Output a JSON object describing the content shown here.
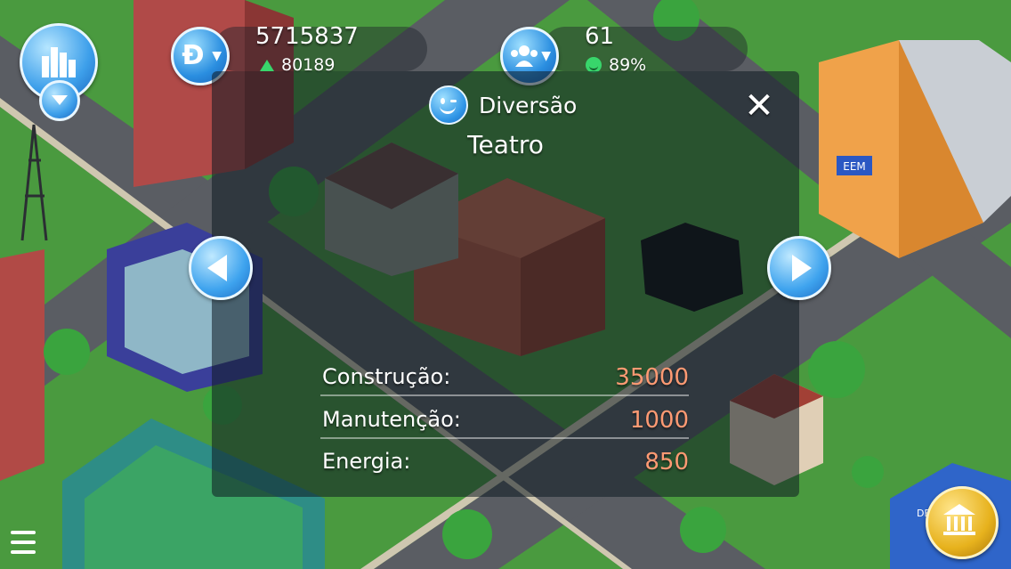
{
  "hud": {
    "money_value": "5715837",
    "money_delta": "80189",
    "population_value": "61",
    "happiness_value": "89%",
    "currency_glyph": "Đ"
  },
  "building_panel": {
    "category_label": "Diversão",
    "building_name": "Teatro",
    "stats": [
      {
        "label": "Construção:",
        "value": "35000"
      },
      {
        "label": "Manutenção:",
        "value": "1000"
      },
      {
        "label": "Energia:",
        "value": "850"
      }
    ]
  },
  "icons": {
    "city_menu": "city-skyline-icon",
    "money": "coin-icon",
    "population": "people-icon",
    "category": "smiley-icon",
    "close": "close-icon",
    "prev": "arrow-left-icon",
    "next": "arrow-right-icon",
    "civic": "city-hall-icon",
    "menu": "list-menu-icon"
  },
  "colors": {
    "stat_value": "#ff9a73",
    "positive": "#38d66b",
    "panel_accent": "#2f95e6"
  },
  "scene_labels": {
    "school_sign": "EEM",
    "police_sign": "DELEG"
  }
}
